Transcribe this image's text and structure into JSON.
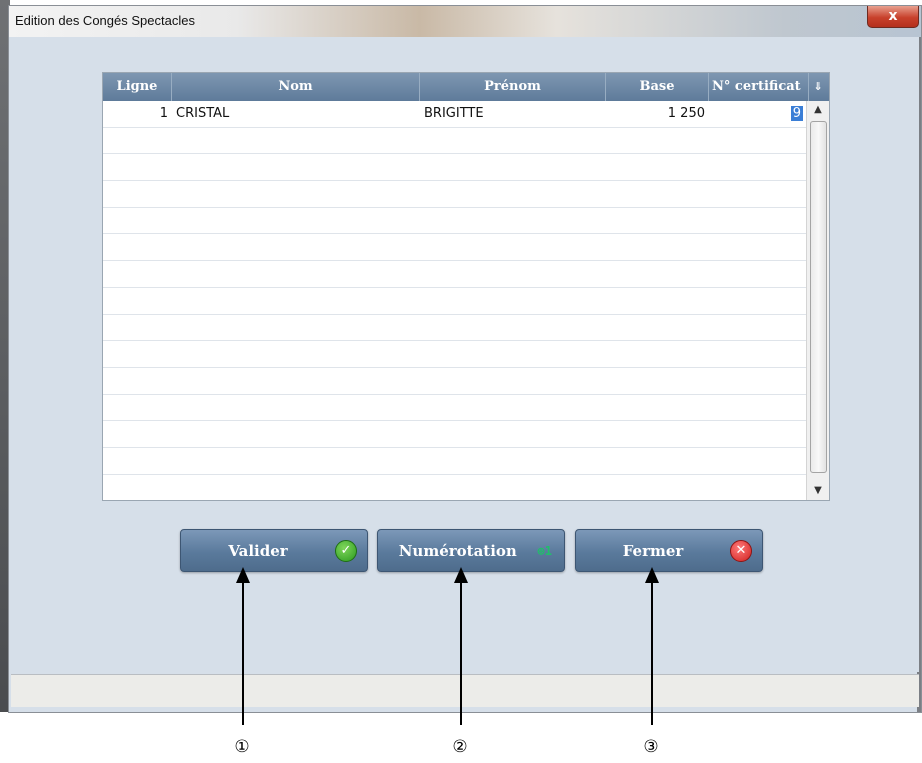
{
  "window": {
    "title": "Edition des Congés Spectacles",
    "close_label": "x"
  },
  "grid": {
    "columns": [
      "Ligne",
      "Nom",
      "Prénom",
      "Base",
      "N° certificat"
    ],
    "sort_icon": "chevron-double-down-icon",
    "rows": [
      {
        "ligne": "1",
        "nom": "CRISTAL",
        "prenom": "BRIGITTE",
        "base": "1 250",
        "certificat": "9"
      }
    ],
    "scroll_up": "▲",
    "scroll_down": "▼"
  },
  "buttons": {
    "validate": {
      "label": "Valider",
      "icon": "check-icon",
      "color": "#2b9a1f"
    },
    "numbering": {
      "label": "Numérotation",
      "icon": "numbering-icon",
      "glyph": "⊕1"
    },
    "close": {
      "label": "Fermer",
      "icon": "close-circle-icon",
      "color": "#d0201e"
    }
  },
  "annotations": {
    "markers": [
      "①",
      "②",
      "③"
    ]
  }
}
